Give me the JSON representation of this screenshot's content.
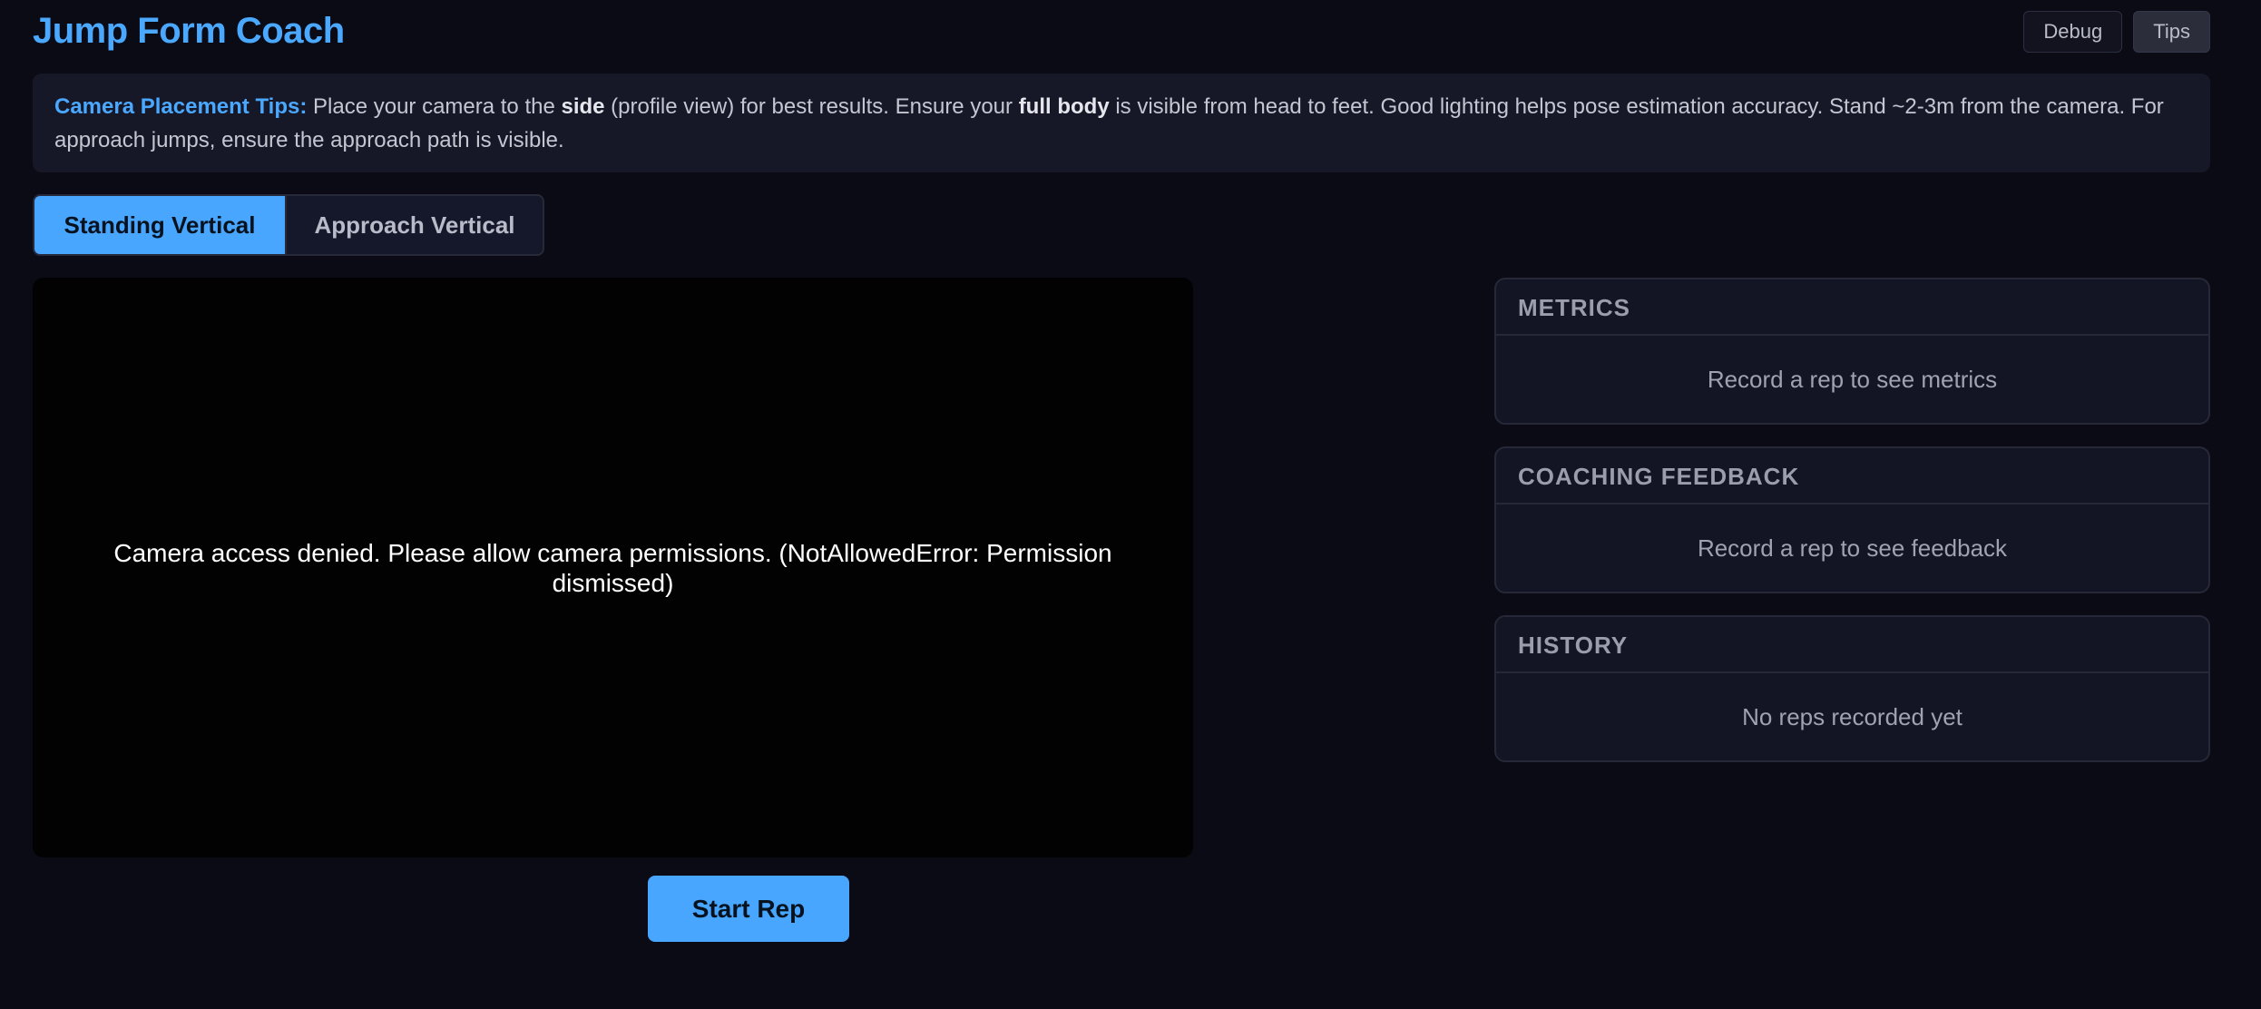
{
  "header": {
    "title": "Jump Form Coach",
    "buttons": {
      "debug": "Debug",
      "tips": "Tips"
    }
  },
  "tips": {
    "lead": "Camera Placement Tips:",
    "t1": " Place your camera to the ",
    "b1": "side",
    "t2": " (profile view) for best results. Ensure your ",
    "b2": "full body",
    "t3": " is visible from head to feet. Good lighting helps pose estimation accuracy. Stand ~2-3m from the camera. For approach jumps, ensure the approach path is visible."
  },
  "modes": {
    "standing": "Standing Vertical",
    "approach": "Approach Vertical",
    "active": "standing"
  },
  "video": {
    "message": "Camera access denied. Please allow camera permissions. (NotAllowedError: Permission dismissed)"
  },
  "controls": {
    "start": "Start Rep"
  },
  "panels": {
    "metrics": {
      "title": "METRICS",
      "empty": "Record a rep to see metrics"
    },
    "feedback": {
      "title": "COACHING FEEDBACK",
      "empty": "Record a rep to see feedback"
    },
    "history": {
      "title": "HISTORY",
      "empty": "No reps recorded yet"
    }
  },
  "colors": {
    "accent": "#49a6ff",
    "background": "#0a0b14",
    "panel": "#141524"
  }
}
